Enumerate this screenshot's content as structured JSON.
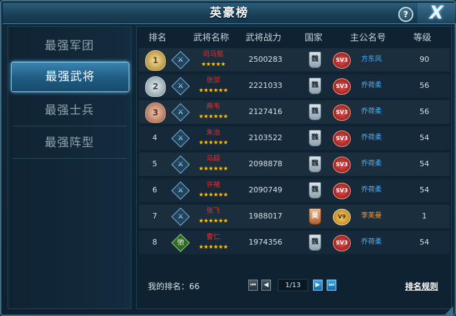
{
  "title": "英豪榜",
  "help_glyph": "?",
  "close_glyph": "X",
  "sidebar": {
    "items": [
      {
        "label": "最强军团",
        "active": false
      },
      {
        "label": "最强武将",
        "active": true
      },
      {
        "label": "最强士兵",
        "active": false
      },
      {
        "label": "最强阵型",
        "active": false
      }
    ]
  },
  "table": {
    "headers": [
      "排名",
      "武将名称",
      "武将战力",
      "国家",
      "主公名号",
      "等级"
    ],
    "rows": [
      {
        "rank": "1",
        "medal": "gold",
        "type_glyph": "⚔",
        "hero_name": "司马懿",
        "stars": "★★★★★",
        "power": "2500283",
        "country": "魏",
        "vip": "SV3",
        "lord": "方东风",
        "level": "90"
      },
      {
        "rank": "2",
        "medal": "silver",
        "type_glyph": "⚔",
        "hero_name": "张郃",
        "stars": "★★★★★★",
        "power": "2221033",
        "country": "魏",
        "vip": "SV3",
        "lord": "乔荷柔",
        "level": "56"
      },
      {
        "rank": "3",
        "medal": "bronze",
        "type_glyph": "⚔",
        "hero_name": "典韦",
        "stars": "★★★★★★",
        "power": "2127416",
        "country": "魏",
        "vip": "SV3",
        "lord": "乔荷柔",
        "level": "56"
      },
      {
        "rank": "4",
        "medal": "",
        "type_glyph": "⚔",
        "hero_name": "朱治",
        "stars": "★★★★★★",
        "power": "2103522",
        "country": "魏",
        "vip": "SV3",
        "lord": "乔荷柔",
        "level": "54"
      },
      {
        "rank": "5",
        "medal": "",
        "type_glyph": "⚔",
        "hero_name": "马超",
        "stars": "★★★★★★",
        "power": "2098878",
        "country": "魏",
        "vip": "SV3",
        "lord": "乔荷柔",
        "level": "54"
      },
      {
        "rank": "6",
        "medal": "",
        "type_glyph": "⚔",
        "hero_name": "许褚",
        "stars": "★★★★★★",
        "power": "2090749",
        "country": "魏",
        "vip": "SV3",
        "lord": "乔荷柔",
        "level": "54"
      },
      {
        "rank": "7",
        "medal": "",
        "type_glyph": "⚔",
        "hero_name": "张飞",
        "stars": "★★★★★★",
        "power": "1988017",
        "country": "吴",
        "vip": "V9",
        "lord": "李芙曼",
        "level": "1"
      },
      {
        "rank": "8",
        "medal": "",
        "type_glyph": "弛",
        "hero_name": "曹仁",
        "stars": "★★★★★★",
        "power": "1974356",
        "country": "魏",
        "vip": "SV3",
        "lord": "乔荷柔",
        "level": "54"
      }
    ]
  },
  "footer": {
    "my_rank_label": "我的排名：66",
    "first_glyph": "⏮",
    "prev_glyph": "◀",
    "page": "1/13",
    "next_glyph": "▶",
    "last_glyph": "⏭",
    "rules_label": "排名规则"
  },
  "colors": {
    "hero_name": "#e03030",
    "stars": "#ffc21a",
    "lord_blue": "#45b4ff",
    "lord_orange": "#ff9a2e"
  }
}
